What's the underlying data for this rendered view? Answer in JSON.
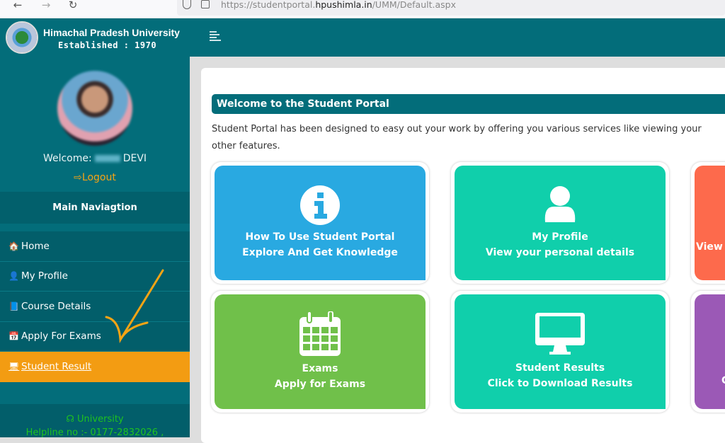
{
  "browser": {
    "url_prefix": "https://studentportal.",
    "url_domain": "hpushimla.in",
    "url_path": "/UMM/Default.aspx",
    "back": "←",
    "forward": "→",
    "reload": "↻"
  },
  "header": {
    "university_name": "Himachal Pradesh University",
    "established": "Established : 1970"
  },
  "profile": {
    "welcome_prefix": "Welcome:",
    "name_suffix": "DEVI",
    "logout_label": "Logout",
    "logout_icon": "⇨"
  },
  "sidebar": {
    "heading": "Main Naviagtion",
    "items": [
      {
        "label": "Home",
        "icon": "🏠"
      },
      {
        "label": "My Profile",
        "icon": "👤"
      },
      {
        "label": "Course Details",
        "icon": "📘"
      },
      {
        "label": "Apply For Exams",
        "icon": "📅"
      },
      {
        "label": "Student Result",
        "icon": "🖥"
      }
    ],
    "active_index": 4,
    "helpline_title": "University",
    "helpline_text": "Helpline no :- 0177-2832026 ,"
  },
  "main": {
    "welcome_title": "Welcome to the Student Portal",
    "description_line1": "Student Portal has been designed to easy out your work by offering you various services like viewing your",
    "description_line2": "other features.",
    "tiles": [
      {
        "title": "How To Use Student Portal",
        "subtitle": "Explore And Get Knowledge",
        "icon": "info-icon",
        "color": "#29a9e1"
      },
      {
        "title": "My Profile",
        "subtitle": "View your personal details",
        "icon": "user-icon",
        "color": "#10cfab"
      },
      {
        "title": "",
        "subtitle": "View y",
        "icon": "",
        "color": "#fd6a4c"
      },
      {
        "title": "Exams",
        "subtitle": "Apply for Exams",
        "icon": "calendar-icon",
        "color": "#70c04a"
      },
      {
        "title": "Student Results",
        "subtitle": "Click to Download Results",
        "icon": "monitor-icon",
        "color": "#10cfab"
      },
      {
        "title": "",
        "subtitle": "C",
        "icon": "",
        "color": "#9b59b6"
      }
    ]
  },
  "colors": {
    "brand_teal": "#036d7a",
    "active_orange": "#f39c12",
    "helpline_green": "#1fc21f"
  }
}
